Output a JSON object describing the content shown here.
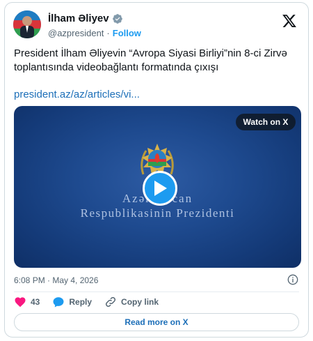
{
  "author": {
    "display_name": "İlham Əliyev",
    "handle": "@azpresident",
    "separator": "·",
    "follow_label": "Follow"
  },
  "tweet": {
    "text": "President İlham Əliyevin “Avropa Siyasi Birliyi”nin 8-ci Zirvə toplantısında videobağlantı formatında çıxışı",
    "link": "president.az/az/articles/vi..."
  },
  "media": {
    "watch_label": "Watch on X",
    "brand_line1": "Azərbaycan",
    "brand_line2": "Respublikasinin Prezidenti"
  },
  "meta": {
    "timestamp": "6:08 PM · May 4, 2026"
  },
  "actions": {
    "like_count": "43",
    "reply_label": "Reply",
    "copy_label": "Copy link",
    "read_more_label": "Read more on X"
  },
  "colors": {
    "accent": "#1d9bf0",
    "like": "#f91880",
    "link": "#1d6fb8",
    "media_bg": "#1e4a8f"
  }
}
